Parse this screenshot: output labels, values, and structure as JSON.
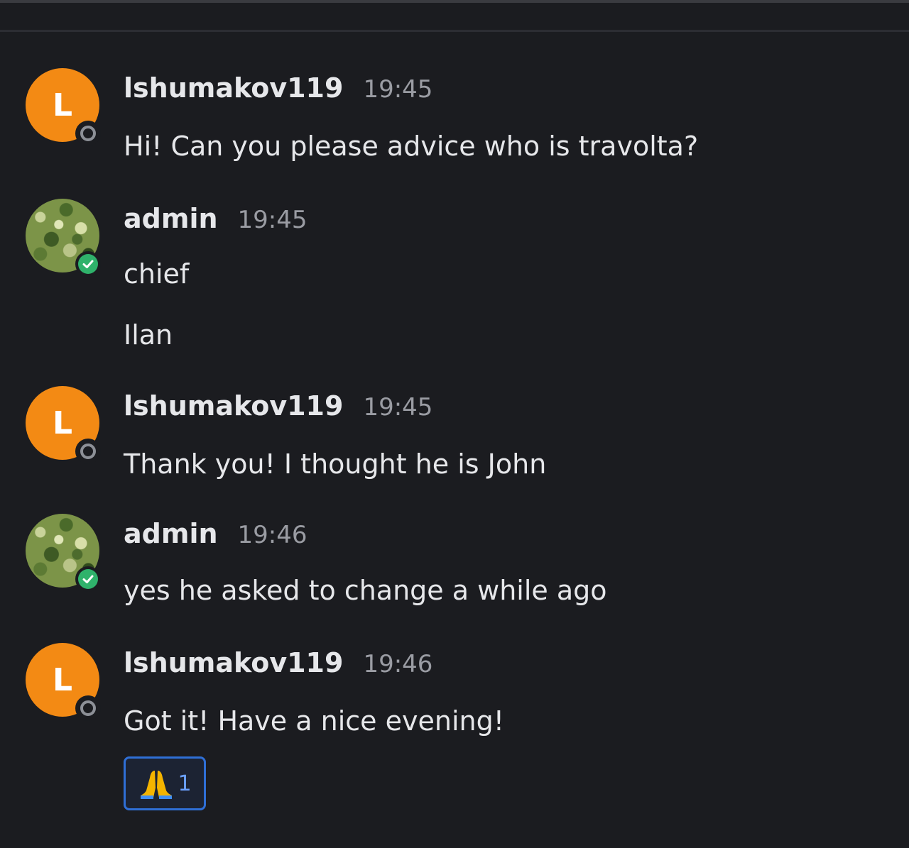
{
  "messages": [
    {
      "username": "lshumakov119",
      "time": "19:45",
      "avatar_letter": "L",
      "status": "offline",
      "lines": [
        "Hi! Can you please advice who is travolta?"
      ]
    },
    {
      "username": "admin",
      "time": "19:45",
      "avatar_letter": "",
      "status": "online",
      "lines": [
        "chief",
        "Ilan"
      ]
    },
    {
      "username": "lshumakov119",
      "time": "19:45",
      "avatar_letter": "L",
      "status": "offline",
      "lines": [
        "Thank you! I thought he is John"
      ]
    },
    {
      "username": "admin",
      "time": "19:46",
      "avatar_letter": "",
      "status": "online",
      "lines": [
        "yes he asked to change a while ago"
      ]
    },
    {
      "username": "lshumakov119",
      "time": "19:46",
      "avatar_letter": "L",
      "status": "offline",
      "lines": [
        "Got it! Have a nice evening!"
      ],
      "reaction": {
        "emoji": "pray-emoji",
        "count": "1"
      }
    }
  ],
  "colors": {
    "background": "#1b1c20",
    "avatar_orange": "#f38a14",
    "online_green": "#2fb26b",
    "reaction_border": "#2f6fd6"
  }
}
